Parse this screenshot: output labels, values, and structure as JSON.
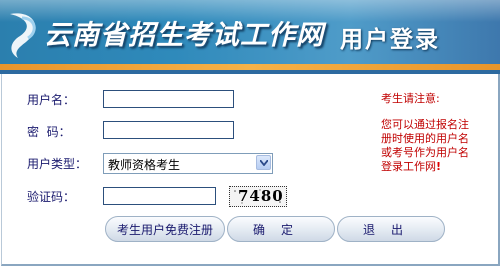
{
  "header": {
    "site_title": "云南省招生考试工作网",
    "page_title": "用户登录"
  },
  "form": {
    "username_label": "用户名：",
    "username_value": "",
    "password_label": "密  码：",
    "password_value": "",
    "user_type_label": "用户类型：",
    "user_type_selected": "教师资格考生",
    "captcha_label": "验证码：",
    "captcha_value": "",
    "captcha_image_text": "7480"
  },
  "notice": {
    "heading": "考生请注意:",
    "body": "您可以通过报名注册时使用的用户名或考号作为用户名登录工作网",
    "mark": "!"
  },
  "buttons": {
    "register": "考生用户免费注册",
    "confirm": "确定",
    "exit": "退出"
  },
  "colors": {
    "banner_blue": "#2f8abb",
    "accent_orange": "#f5b248",
    "label_text": "#1a1a6e",
    "notice_red": "#c00000"
  },
  "icons": {
    "logo": "swoosh-logo-icon",
    "dropdown": "chevron-down-icon"
  }
}
